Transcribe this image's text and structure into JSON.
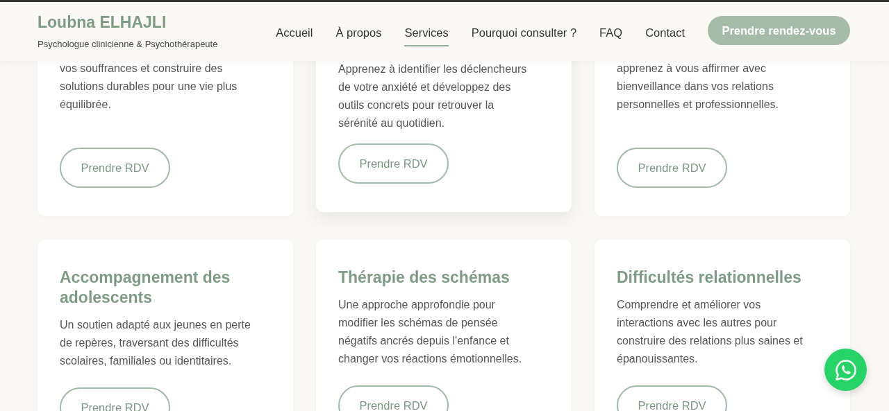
{
  "header": {
    "brand": "Loubna ELHAJLI",
    "tagline": "Psychologue clinicienne & Psychothérapeute",
    "nav": [
      {
        "label": "Accueil",
        "selected": false
      },
      {
        "label": "À propos",
        "selected": false
      },
      {
        "label": "Services",
        "selected": true
      },
      {
        "label": "Pourquoi consulter ?",
        "selected": false
      },
      {
        "label": "FAQ",
        "selected": false
      },
      {
        "label": "Contact",
        "selected": false
      }
    ],
    "cta": "Prendre rendez-vous"
  },
  "services": [
    {
      "text": [
        "vos souffrances et construire des",
        "solutions durables pour une vie plus",
        "équilibrée."
      ],
      "button": "Prendre RDV",
      "hovered": false
    },
    {
      "text": [
        "Apprenez à identifier les déclencheurs",
        "de votre anxiété et développez des",
        "outils concrets pour retrouver la",
        "sérénité au quotidien."
      ],
      "button": "Prendre RDV",
      "hovered": true
    },
    {
      "text": [
        "apprenez à vous affirmer avec",
        "bienveillance dans vos relations",
        "personnelles et professionnelles."
      ],
      "button": "Prendre RDV",
      "hovered": false
    },
    {
      "title": "Accompagnement des adolescents",
      "text": [
        "Un soutien adapté aux jeunes en perte",
        "de repères, traversant des difficultés",
        "scolaires, familiales ou identitaires."
      ],
      "button": "Prendre RDV",
      "hovered": false
    },
    {
      "title": "Thérapie des schémas",
      "text": [
        "Une approche approfondie pour",
        "modifier les schémas de pensée",
        "négatifs ancrés depuis l'enfance et",
        "changer vos réactions émotionnelles."
      ],
      "button": "Prendre RDV",
      "hovered": false
    },
    {
      "title": "Difficultés relationnelles",
      "text": [
        "Comprendre et améliorer vos",
        "interactions avec les autres pour",
        "construire des relations plus saines et",
        "épanouissantes."
      ],
      "button": "Prendre RDV",
      "hovered": false
    }
  ]
}
